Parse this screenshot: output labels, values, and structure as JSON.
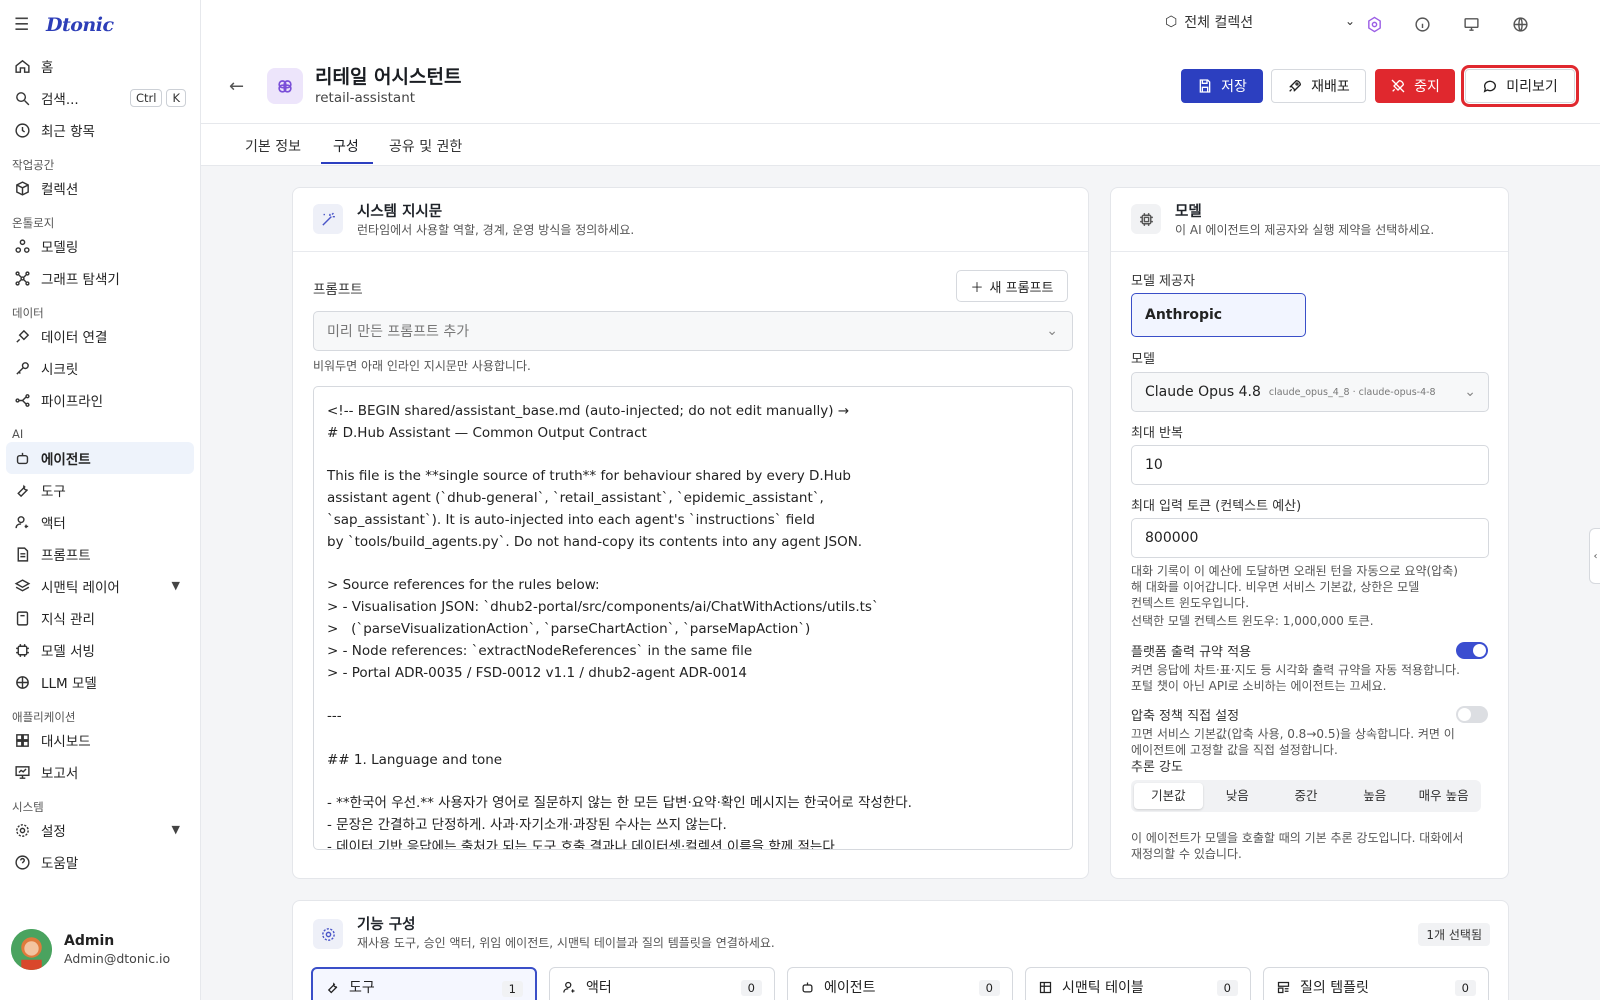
{
  "app": {
    "logo": "Dtonic"
  },
  "sidebar": {
    "items": [
      {
        "label": "홈",
        "icon": "home-icon"
      },
      {
        "label": "검색...",
        "icon": "search-icon",
        "shortcut": [
          "Ctrl",
          "K"
        ]
      },
      {
        "label": "최근 항목",
        "icon": "clock-icon"
      }
    ],
    "sections": [
      {
        "title": "작업공간",
        "items": [
          {
            "label": "컬렉션",
            "icon": "cube-icon"
          }
        ]
      },
      {
        "title": "온톨로지",
        "items": [
          {
            "label": "모델링",
            "icon": "share-nodes-icon"
          },
          {
            "label": "그래프 탐색기",
            "icon": "graph-icon"
          }
        ]
      },
      {
        "title": "데이터",
        "items": [
          {
            "label": "데이터 연결",
            "icon": "plug-icon"
          },
          {
            "label": "시크릿",
            "icon": "key-icon"
          },
          {
            "label": "파이프라인",
            "icon": "pipeline-icon"
          }
        ]
      },
      {
        "title": "AI",
        "items": [
          {
            "label": "에이전트",
            "icon": "bot-icon"
          },
          {
            "label": "도구",
            "icon": "wrench-icon"
          },
          {
            "label": "액터",
            "icon": "user-gear-icon"
          },
          {
            "label": "프롬프트",
            "icon": "document-icon"
          },
          {
            "label": "시맨틱 레이어",
            "icon": "layers-icon"
          },
          {
            "label": "지식 관리",
            "icon": "book-icon"
          },
          {
            "label": "모델 서빙",
            "icon": "cpu-icon"
          },
          {
            "label": "LLM 모델",
            "icon": "brain-icon"
          }
        ]
      },
      {
        "title": "애플리케이션",
        "items": [
          {
            "label": "대시보드",
            "icon": "dashboard-icon"
          },
          {
            "label": "보고서",
            "icon": "presentation-icon"
          }
        ]
      },
      {
        "title": "시스템",
        "items": [
          {
            "label": "설정",
            "icon": "gear-icon"
          },
          {
            "label": "도움말",
            "icon": "help-icon"
          }
        ]
      }
    ],
    "user": {
      "name": "Admin",
      "email": "Admin@dtonic.io"
    }
  },
  "topbar": {
    "collection": "전체 컬렉션"
  },
  "header": {
    "title": "리테일 어시스턴트",
    "subtitle": "retail-assistant",
    "save": "저장",
    "redeploy": "재배포",
    "stop": "중지",
    "preview": "미리보기"
  },
  "tabs": [
    "기본 정보",
    "구성",
    "공유 및 권한"
  ],
  "instructions": {
    "title": "시스템 지시문",
    "desc": "런타임에서 사용할 역할, 경계, 운영 방식을 정의하세요.",
    "prompt_label": "프롬프트",
    "new_prompt": "새 프롬프트",
    "preset_placeholder": "미리 만든 프롬프트 추가",
    "preset_hint": "비워두면 아래 인라인 지시문만 사용합니다.",
    "text": "<!-- BEGIN shared/assistant_base.md (auto-injected; do not edit manually) →\n# D.Hub Assistant — Common Output Contract\n\nThis file is the **single source of truth** for behaviour shared by every D.Hub\nassistant agent (`dhub-general`, `retail_assistant`, `epidemic_assistant`,\n`sap_assistant`). It is auto-injected into each agent's `instructions` field\nby `tools/build_agents.py`. Do not hand-copy its contents into any agent JSON.\n\n> Source references for the rules below:\n> - Visualisation JSON: `dhub2-portal/src/components/ai/ChatWithActions/utils.ts`\n>   (`parseVisualizationAction`, `parseChartAction`, `parseMapAction`)\n> - Node references: `extractNodeReferences` in the same file\n> - Portal ADR-0035 / FSD-0012 v1.1 / dhub2-agent ADR-0014\n\n---\n\n## 1. Language and tone\n\n- **한국어 우선.** 사용자가 영어로 질문하지 않는 한 모든 답변·요약·확인 메시지는 한국어로 작성한다.\n- 문장은 간결하고 단정하게. 사과·자기소개·과장된 수사는 쓰지 않는다.\n- 데이터 기반 응답에는 출처가 되는 도구 호출 결과나 데이터셋·컬렉션 이름을 함께 적는다."
  },
  "model": {
    "title": "모델",
    "desc": "이 AI 에이전트의 제공자와 실행 제약을 선택하세요.",
    "provider_label": "모델 제공자",
    "provider": "Anthropic",
    "model_label": "모델",
    "model_name": "Claude Opus 4.8",
    "model_id": "claude_opus_4_8 · claude-opus-4-8",
    "max_iter_label": "최대 반복",
    "max_iter": "10",
    "max_tokens_label": "최대 입력 토큰 (컨텍스트 예산)",
    "max_tokens": "800000",
    "tokens_hint": "대화 기록이 이 예산에 도달하면 오래된 턴을 자동으로 요약(압축)\n해 대화를 이어갑니다. 비우면 서비스 기본값, 상한은 모델\n컨텍스트 윈도우입니다.",
    "window_hint": "선택한 모델 컨텍스트 윈도우: 1,000,000 토큰.",
    "platform_label": "플랫폼 출력 규약 적용",
    "platform_on": true,
    "platform_hint": "켜면 응답에 차트·표·지도 등 시각화 출력 규약을 자동 적용합니다.\n포털 챗이 아닌 API로 소비하는 에이전트는 끄세요.",
    "compress_label": "압축 정책 직접 설정",
    "compress_on": false,
    "compress_hint": "끄면 서비스 기본값(압축 사용, 0.8→0.5)을 상속합니다. 켜면 이\n에이전트에 고정할 값을 직접 설정합니다.",
    "reasoning_label": "추론 강도",
    "reasoning_options": [
      "기본값",
      "낮음",
      "중간",
      "높음",
      "매우 높음"
    ],
    "reasoning_selected": "기본값",
    "reasoning_hint": "이 에이전트가 모델을 호출할 때의 기본 추론 강도입니다. 대화에서\n재정의할 수 있습니다."
  },
  "features": {
    "title": "기능 구성",
    "desc": "재사용 도구, 승인 액터, 위임 에이전트, 시맨틱 테이블과 질의 템플릿을 연결하세요.",
    "badge": "1개 선택됨",
    "tabs": [
      {
        "label": "도구",
        "count": "1"
      },
      {
        "label": "액터",
        "count": "0"
      },
      {
        "label": "에이전트",
        "count": "0"
      },
      {
        "label": "시맨틱 테이블",
        "count": "0"
      },
      {
        "label": "질의 템플릿",
        "count": "0"
      }
    ]
  },
  "colors": {
    "accent": "#2c3fc0",
    "danger": "#e0282e",
    "toggle_on": "#3b4ed0"
  }
}
